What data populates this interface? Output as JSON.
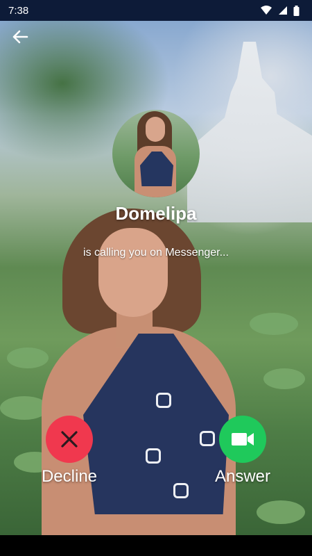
{
  "status_bar": {
    "time": "7:38",
    "icons": [
      "wifi-icon",
      "signal-icon",
      "battery-icon"
    ]
  },
  "header": {
    "back_icon": "arrow-back-icon"
  },
  "caller": {
    "name": "Domelipa",
    "status": "is calling you on Messenger..."
  },
  "actions": {
    "decline": {
      "label": "Decline",
      "icon": "close-icon",
      "color": "#f0384e"
    },
    "answer": {
      "label": "Answer",
      "icon": "video-camera-icon",
      "color": "#1fc95b"
    }
  },
  "colors": {
    "status_bar_bg": "#0d1b38",
    "nav_bar_bg": "#000000"
  }
}
